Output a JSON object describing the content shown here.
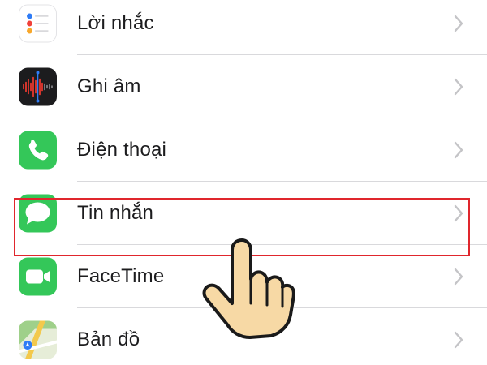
{
  "settings_list": {
    "items": [
      {
        "label": "Lời nhắc",
        "icon": "reminders-icon"
      },
      {
        "label": "Ghi âm",
        "icon": "voice-memos-icon"
      },
      {
        "label": "Điện thoại",
        "icon": "phone-icon"
      },
      {
        "label": "Tin nhắn",
        "icon": "messages-icon",
        "highlighted": true
      },
      {
        "label": "FaceTime",
        "icon": "facetime-icon"
      },
      {
        "label": "Bản đồ",
        "icon": "maps-icon"
      }
    ]
  },
  "colors": {
    "highlight_border": "#e0262d",
    "ios_green": "#34c759",
    "label_text": "#1c1c1e",
    "separator": "#d9d9dc",
    "chevron": "#c4c4c7"
  }
}
